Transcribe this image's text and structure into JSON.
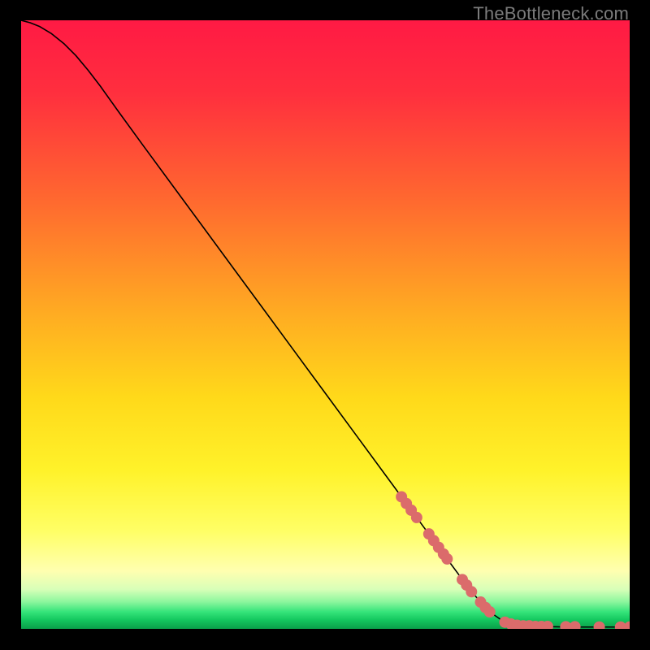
{
  "watermark": "TheBottleneck.com",
  "chart_data": {
    "type": "line",
    "title": "",
    "xlabel": "",
    "ylabel": "",
    "xlim": [
      0,
      100
    ],
    "ylim": [
      0,
      100
    ],
    "grid": false,
    "legend": false,
    "background": {
      "kind": "vertical-gradient",
      "description": "red at top through orange, yellow, pale-yellow, thin green band near bottom, darker green at extreme bottom",
      "stops": [
        {
          "offset": 0.0,
          "color": "#ff1a44"
        },
        {
          "offset": 0.12,
          "color": "#ff2f3e"
        },
        {
          "offset": 0.3,
          "color": "#ff6a2f"
        },
        {
          "offset": 0.48,
          "color": "#ffab22"
        },
        {
          "offset": 0.62,
          "color": "#ffd91a"
        },
        {
          "offset": 0.74,
          "color": "#fff22a"
        },
        {
          "offset": 0.84,
          "color": "#ffff66"
        },
        {
          "offset": 0.905,
          "color": "#ffffb0"
        },
        {
          "offset": 0.935,
          "color": "#d8ffb8"
        },
        {
          "offset": 0.955,
          "color": "#8ef79e"
        },
        {
          "offset": 0.972,
          "color": "#35e47a"
        },
        {
          "offset": 0.985,
          "color": "#14c85f"
        },
        {
          "offset": 1.0,
          "color": "#0a9e4a"
        }
      ]
    },
    "series": [
      {
        "name": "curve",
        "kind": "line",
        "color": "#000000",
        "width": 1.6,
        "points": [
          {
            "x": 0.0,
            "y": 100.0
          },
          {
            "x": 1.5,
            "y": 99.6
          },
          {
            "x": 3.0,
            "y": 99.0
          },
          {
            "x": 5.0,
            "y": 97.8
          },
          {
            "x": 7.0,
            "y": 96.2
          },
          {
            "x": 9.0,
            "y": 94.2
          },
          {
            "x": 11.0,
            "y": 91.8
          },
          {
            "x": 13.0,
            "y": 89.2
          },
          {
            "x": 16.0,
            "y": 85.0
          },
          {
            "x": 20.0,
            "y": 79.5
          },
          {
            "x": 25.0,
            "y": 72.7
          },
          {
            "x": 30.0,
            "y": 65.9
          },
          {
            "x": 35.0,
            "y": 59.1
          },
          {
            "x": 40.0,
            "y": 52.3
          },
          {
            "x": 45.0,
            "y": 45.5
          },
          {
            "x": 50.0,
            "y": 38.7
          },
          {
            "x": 55.0,
            "y": 31.9
          },
          {
            "x": 60.0,
            "y": 25.1
          },
          {
            "x": 65.0,
            "y": 18.3
          },
          {
            "x": 70.0,
            "y": 11.5
          },
          {
            "x": 74.0,
            "y": 6.1
          },
          {
            "x": 77.0,
            "y": 2.8
          },
          {
            "x": 79.0,
            "y": 1.4
          },
          {
            "x": 81.0,
            "y": 0.7
          },
          {
            "x": 85.0,
            "y": 0.4
          },
          {
            "x": 90.0,
            "y": 0.3
          },
          {
            "x": 95.0,
            "y": 0.3
          },
          {
            "x": 100.0,
            "y": 0.3
          }
        ]
      },
      {
        "name": "markers",
        "kind": "scatter",
        "color": "#db6b6b",
        "radius": 7,
        "points": [
          {
            "x": 62.5,
            "y": 21.7
          },
          {
            "x": 63.3,
            "y": 20.6
          },
          {
            "x": 64.1,
            "y": 19.5
          },
          {
            "x": 65.0,
            "y": 18.3
          },
          {
            "x": 67.0,
            "y": 15.6
          },
          {
            "x": 67.8,
            "y": 14.5
          },
          {
            "x": 68.6,
            "y": 13.4
          },
          {
            "x": 69.4,
            "y": 12.3
          },
          {
            "x": 70.0,
            "y": 11.5
          },
          {
            "x": 72.5,
            "y": 8.1
          },
          {
            "x": 73.2,
            "y": 7.2
          },
          {
            "x": 74.0,
            "y": 6.1
          },
          {
            "x": 75.5,
            "y": 4.4
          },
          {
            "x": 76.3,
            "y": 3.5
          },
          {
            "x": 77.0,
            "y": 2.8
          },
          {
            "x": 79.5,
            "y": 1.1
          },
          {
            "x": 80.5,
            "y": 0.8
          },
          {
            "x": 81.5,
            "y": 0.6
          },
          {
            "x": 82.5,
            "y": 0.5
          },
          {
            "x": 83.5,
            "y": 0.5
          },
          {
            "x": 84.5,
            "y": 0.4
          },
          {
            "x": 85.5,
            "y": 0.4
          },
          {
            "x": 86.5,
            "y": 0.4
          },
          {
            "x": 89.5,
            "y": 0.35
          },
          {
            "x": 91.0,
            "y": 0.35
          },
          {
            "x": 95.0,
            "y": 0.3
          },
          {
            "x": 98.5,
            "y": 0.3
          },
          {
            "x": 100.0,
            "y": 0.3
          }
        ]
      }
    ]
  }
}
